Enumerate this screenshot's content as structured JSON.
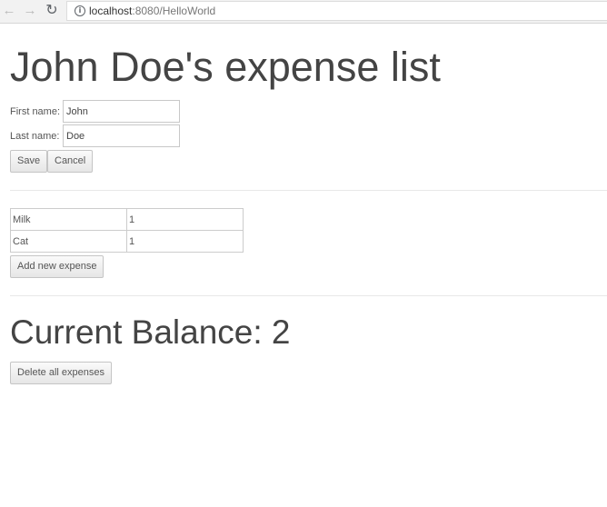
{
  "browser": {
    "url_host": "localhost",
    "url_rest": ":8080/HelloWorld"
  },
  "page": {
    "title": "John Doe's expense list"
  },
  "form": {
    "first_name_label": "First name:",
    "first_name_value": "John",
    "last_name_label": "Last name:",
    "last_name_value": "Doe",
    "save_label": "Save",
    "cancel_label": "Cancel"
  },
  "expenses": {
    "rows": [
      {
        "name": "Milk",
        "amount": "1"
      },
      {
        "name": "Cat",
        "amount": "1"
      }
    ],
    "add_label": "Add new expense"
  },
  "balance": {
    "heading": "Current Balance: 2",
    "delete_label": "Delete all expenses"
  },
  "icons": {
    "back": "back-arrow-icon",
    "forward": "forward-arrow-icon",
    "reload": "reload-icon",
    "info": "info-icon"
  }
}
